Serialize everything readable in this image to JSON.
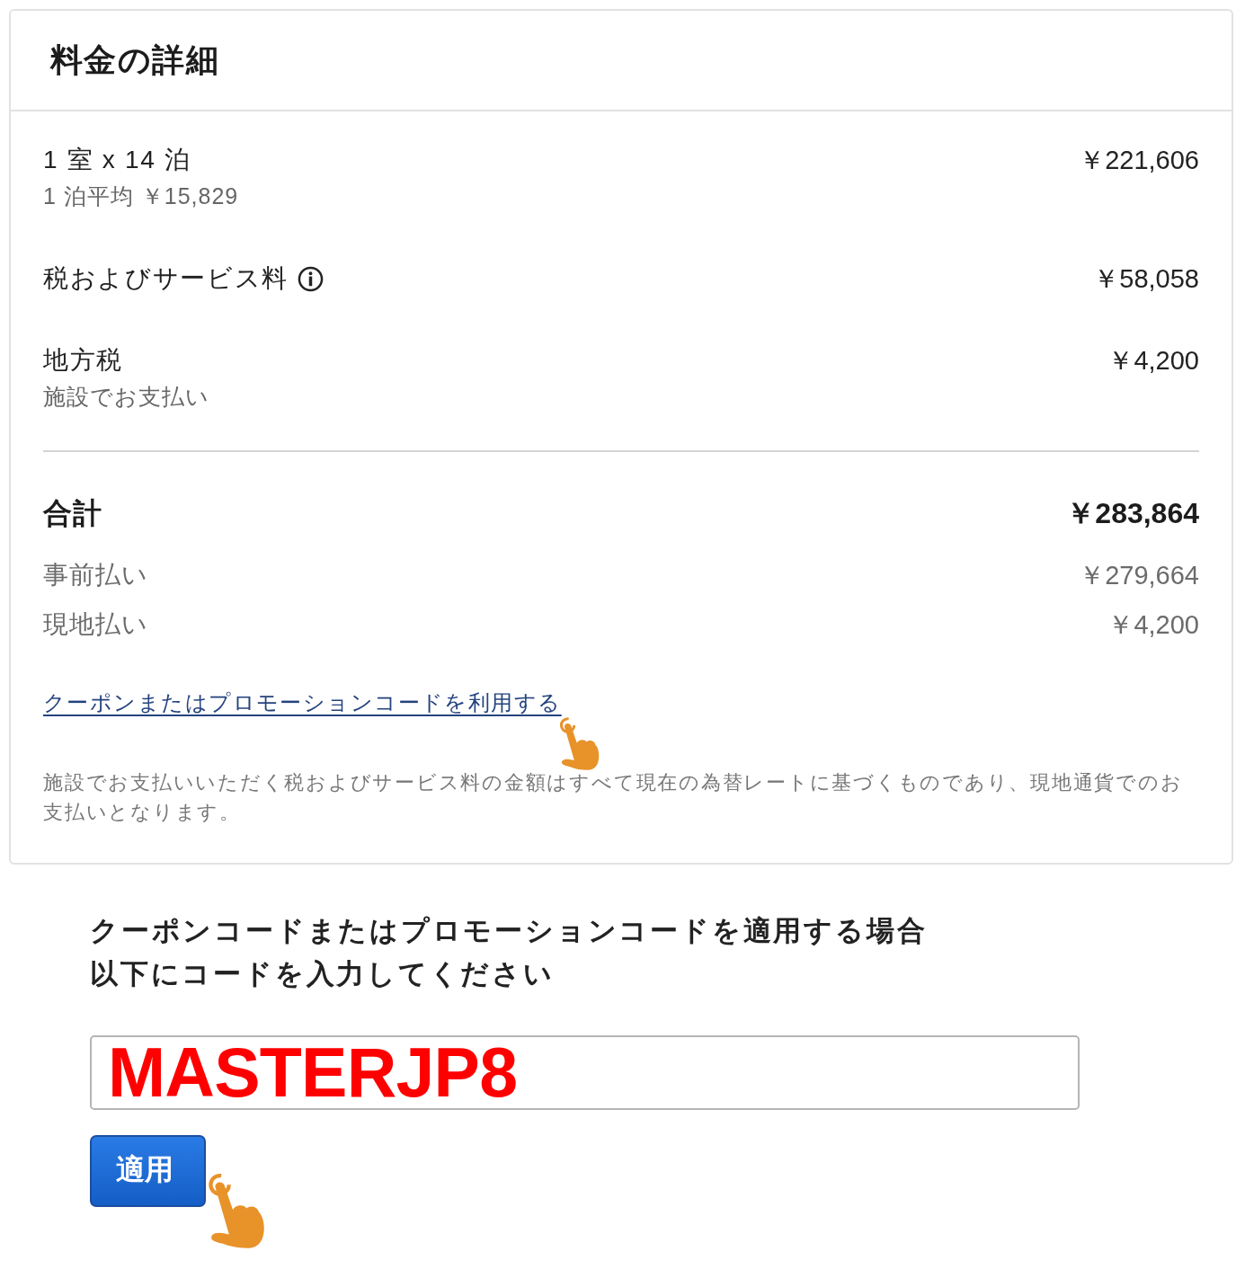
{
  "card": {
    "title": "料金の詳細",
    "line_items": [
      {
        "label": "1 室 x 14 泊",
        "sublabel": "1 泊平均 ￥15,829",
        "amount": "￥221,606",
        "info": false
      },
      {
        "label": "税およびサービス料",
        "amount": "￥58,058",
        "info": true
      },
      {
        "label": "地方税",
        "sublabel": "施設でお支払い",
        "amount": "￥4,200",
        "info": false
      }
    ],
    "total": {
      "label": "合計",
      "amount": "￥283,864"
    },
    "payments": [
      {
        "label": "事前払い",
        "amount": "￥279,664"
      },
      {
        "label": "現地払い",
        "amount": "￥4,200"
      }
    ],
    "coupon_link": "クーポンまたはプロモーションコードを利用する",
    "note": "施設でお支払いいただく税およびサービス料の金額はすべて現在の為替レートに基づくものであり、現地通貨でのお支払いとなります。"
  },
  "coupon_form": {
    "heading_lines": [
      "クーポンコードまたはプロモーションコードを適用する場合",
      "以下にコードを入力してください"
    ],
    "code_value": "MASTERJP8",
    "apply_button": "適用"
  }
}
